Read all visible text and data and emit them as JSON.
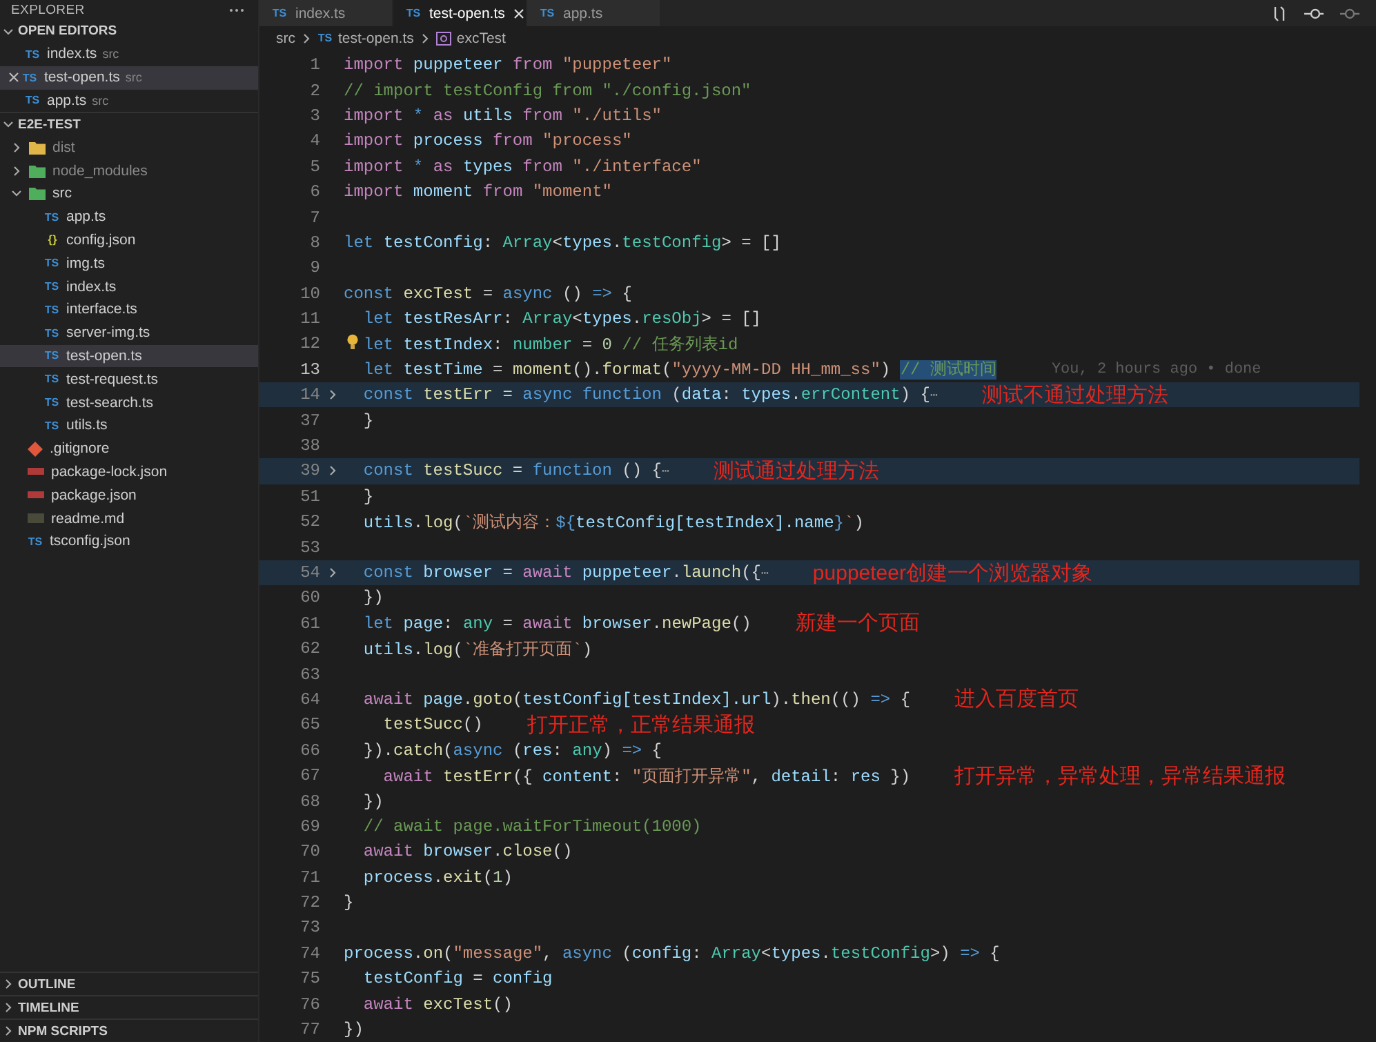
{
  "sidebar": {
    "title": "EXPLORER",
    "open_editors": {
      "title": "OPEN EDITORS",
      "expanded": true,
      "items": [
        {
          "name": "index.ts",
          "dir": "src",
          "kind": "ts",
          "badge": "TS",
          "selected": false
        },
        {
          "name": "test-open.ts",
          "dir": "src",
          "kind": "ts",
          "badge": "TS",
          "selected": true
        },
        {
          "name": "app.ts",
          "dir": "src",
          "kind": "ts",
          "badge": "TS",
          "selected": false
        }
      ]
    },
    "project": {
      "title": "E2E-TEST",
      "expanded": true,
      "items": [
        {
          "name": "dist",
          "kind": "dist",
          "dimmed": true,
          "expanded": false,
          "selected": false
        },
        {
          "name": "node_modules",
          "kind": "modules",
          "dimmed": true,
          "expanded": false,
          "selected": false
        },
        {
          "name": "src",
          "kind": "source",
          "dimmed": false,
          "expanded": true,
          "selected": false,
          "children": [
            {
              "name": "app.ts",
              "kind": "ts",
              "badge": "TS",
              "selected": false
            },
            {
              "name": "config.json",
              "kind": "json",
              "badge": "{ }",
              "selected": false
            },
            {
              "name": "img.ts",
              "kind": "ts",
              "badge": "TS",
              "selected": false
            },
            {
              "name": "index.ts",
              "kind": "ts",
              "badge": "TS",
              "selected": false
            },
            {
              "name": "interface.ts",
              "kind": "ts",
              "badge": "TS",
              "selected": false
            },
            {
              "name": "server-img.ts",
              "kind": "ts",
              "badge": "TS",
              "selected": false
            },
            {
              "name": "test-open.ts",
              "kind": "ts",
              "badge": "TS",
              "selected": true
            },
            {
              "name": "test-request.ts",
              "kind": "ts",
              "badge": "TS",
              "selected": false
            },
            {
              "name": "test-search.ts",
              "kind": "ts",
              "badge": "TS",
              "selected": false
            },
            {
              "name": "utils.ts",
              "kind": "ts",
              "badge": "TS",
              "selected": false
            }
          ]
        },
        {
          "name": ".gitignore",
          "kind": "git",
          "selected": false
        },
        {
          "name": "package-lock.json",
          "kind": "npm",
          "selected": false
        },
        {
          "name": "package.json",
          "kind": "npm",
          "selected": false
        },
        {
          "name": "readme.md",
          "kind": "md",
          "selected": false
        },
        {
          "name": "tsconfig.json",
          "kind": "tsconfig",
          "badge": "TS",
          "selected": false
        }
      ]
    },
    "panels": [
      {
        "title": "OUTLINE",
        "expanded": false
      },
      {
        "title": "TIMELINE",
        "expanded": false
      },
      {
        "title": "NPM SCRIPTS",
        "expanded": false
      }
    ]
  },
  "tabs": [
    {
      "label": "index.ts",
      "badge": "TS",
      "selected": false
    },
    {
      "label": "test-open.ts",
      "badge": "TS",
      "selected": true
    },
    {
      "label": "app.ts",
      "badge": "TS",
      "selected": false
    }
  ],
  "breadcrumb": {
    "folder": "src",
    "file": "test-open.ts",
    "file_badge": "TS",
    "symbol": "excTest"
  },
  "lines": [
    {
      "n": "1",
      "code": [
        {
          "text": "import ",
          "kind": "kw"
        },
        {
          "text": "puppeteer ",
          "kind": "var"
        },
        {
          "text": "from ",
          "kind": "kw"
        },
        {
          "text": "\"puppeteer\"",
          "kind": "str"
        }
      ]
    },
    {
      "n": "2",
      "code": [
        {
          "text": "// import testConfig from \"./config.json\"",
          "kind": "cm"
        }
      ]
    },
    {
      "n": "3",
      "code": [
        {
          "text": "import ",
          "kind": "kw"
        },
        {
          "text": "* ",
          "kind": "decl"
        },
        {
          "text": "as ",
          "kind": "kw"
        },
        {
          "text": "utils ",
          "kind": "var"
        },
        {
          "text": "from ",
          "kind": "kw"
        },
        {
          "text": "\"./utils\"",
          "kind": "str"
        }
      ]
    },
    {
      "n": "4",
      "code": [
        {
          "text": "import ",
          "kind": "kw"
        },
        {
          "text": "process ",
          "kind": "var"
        },
        {
          "text": "from ",
          "kind": "kw"
        },
        {
          "text": "\"process\"",
          "kind": "str"
        }
      ]
    },
    {
      "n": "5",
      "code": [
        {
          "text": "import ",
          "kind": "kw"
        },
        {
          "text": "* ",
          "kind": "decl"
        },
        {
          "text": "as ",
          "kind": "kw"
        },
        {
          "text": "types ",
          "kind": "var"
        },
        {
          "text": "from ",
          "kind": "kw"
        },
        {
          "text": "\"./interface\"",
          "kind": "str"
        }
      ]
    },
    {
      "n": "6",
      "code": [
        {
          "text": "import ",
          "kind": "kw"
        },
        {
          "text": "moment ",
          "kind": "var"
        },
        {
          "text": "from ",
          "kind": "kw"
        },
        {
          "text": "\"moment\"",
          "kind": "str"
        }
      ]
    },
    {
      "n": "7"
    },
    {
      "n": "8",
      "code": [
        {
          "text": "let ",
          "kind": "decl"
        },
        {
          "text": "testConfig",
          "kind": "var"
        },
        {
          "text": ": ",
          "kind": "p"
        },
        {
          "text": "Array",
          "kind": "type"
        },
        {
          "text": "<",
          "kind": "p"
        },
        {
          "text": "types",
          "kind": "var"
        },
        {
          "text": ".",
          "kind": "p"
        },
        {
          "text": "testConfig",
          "kind": "type"
        },
        {
          "text": "> = []",
          "kind": "p"
        }
      ]
    },
    {
      "n": "9"
    },
    {
      "n": "10",
      "code": [
        {
          "text": "const ",
          "kind": "decl"
        },
        {
          "text": "excTest",
          "kind": "fn"
        },
        {
          "text": " = ",
          "kind": "p"
        },
        {
          "text": "async ",
          "kind": "decl"
        },
        {
          "text": "() ",
          "kind": "p"
        },
        {
          "text": "=> ",
          "kind": "decl"
        },
        {
          "text": "{",
          "kind": "p"
        }
      ]
    },
    {
      "n": "11",
      "code": [
        {
          "text": "  let ",
          "kind": "decl"
        },
        {
          "text": "testResArr",
          "kind": "var"
        },
        {
          "text": ": ",
          "kind": "p"
        },
        {
          "text": "Array",
          "kind": "type"
        },
        {
          "text": "<",
          "kind": "p"
        },
        {
          "text": "types",
          "kind": "var"
        },
        {
          "text": ".",
          "kind": "p"
        },
        {
          "text": "resObj",
          "kind": "type"
        },
        {
          "text": "> = []",
          "kind": "p"
        }
      ]
    },
    {
      "n": "12",
      "lightbulb": true,
      "code": [
        {
          "text": "  let ",
          "kind": "decl"
        },
        {
          "text": "testIndex",
          "kind": "var"
        },
        {
          "text": ": ",
          "kind": "p"
        },
        {
          "text": "number",
          "kind": "type"
        },
        {
          "text": " = ",
          "kind": "p"
        },
        {
          "text": "0 ",
          "kind": "num"
        },
        {
          "text": "// 任务列表id",
          "kind": "cm"
        }
      ]
    },
    {
      "n": "13",
      "current": true,
      "code": [
        {
          "text": "  let ",
          "kind": "decl"
        },
        {
          "text": "testTime",
          "kind": "var"
        },
        {
          "text": " = ",
          "kind": "p"
        },
        {
          "text": "moment",
          "kind": "fn"
        },
        {
          "text": "().",
          "kind": "p"
        },
        {
          "text": "format",
          "kind": "fn"
        },
        {
          "text": "(",
          "kind": "p"
        },
        {
          "text": "\"yyyy-MM-DD HH_mm_ss\"",
          "kind": "str"
        },
        {
          "text": ") ",
          "kind": "p"
        },
        {
          "text": "// 测试时间",
          "kind": "sel"
        }
      ],
      "blame": "You, 2 hours ago • done"
    },
    {
      "n": "14",
      "fold": true,
      "highlighted": true,
      "code": [
        {
          "text": "  const ",
          "kind": "decl"
        },
        {
          "text": "testErr",
          "kind": "fn"
        },
        {
          "text": " = ",
          "kind": "p"
        },
        {
          "text": "async function ",
          "kind": "decl"
        },
        {
          "text": "(",
          "kind": "p"
        },
        {
          "text": "data",
          "kind": "var"
        },
        {
          "text": ": ",
          "kind": "p"
        },
        {
          "text": "types",
          "kind": "var"
        },
        {
          "text": ".",
          "kind": "p"
        },
        {
          "text": "errContent",
          "kind": "type"
        },
        {
          "text": ") {",
          "kind": "p"
        },
        {
          "text": "⋯",
          "kind": "ell"
        }
      ],
      "note": "测试不通过处理方法"
    },
    {
      "n": "37",
      "code": [
        {
          "text": "  }",
          "kind": "p"
        }
      ]
    },
    {
      "n": "38"
    },
    {
      "n": "39",
      "fold": true,
      "highlighted": true,
      "code": [
        {
          "text": "  const ",
          "kind": "decl"
        },
        {
          "text": "testSucc",
          "kind": "fn"
        },
        {
          "text": " = ",
          "kind": "p"
        },
        {
          "text": "function ",
          "kind": "decl"
        },
        {
          "text": "() {",
          "kind": "p"
        },
        {
          "text": "⋯",
          "kind": "ell"
        }
      ],
      "note": "测试通过处理方法"
    },
    {
      "n": "51",
      "code": [
        {
          "text": "  }",
          "kind": "p"
        }
      ]
    },
    {
      "n": "52",
      "code": [
        {
          "text": "  utils",
          "kind": "var"
        },
        {
          "text": ".",
          "kind": "p"
        },
        {
          "text": "log",
          "kind": "fn"
        },
        {
          "text": "(",
          "kind": "p"
        },
        {
          "text": "`测试内容：",
          "kind": "str"
        },
        {
          "text": "${",
          "kind": "decl"
        },
        {
          "text": "testConfig[testIndex].name",
          "kind": "var"
        },
        {
          "text": "}",
          "kind": "decl"
        },
        {
          "text": "`",
          "kind": "str"
        },
        {
          "text": ")",
          "kind": "p"
        }
      ]
    },
    {
      "n": "53"
    },
    {
      "n": "54",
      "fold": true,
      "highlighted": true,
      "code": [
        {
          "text": "  const ",
          "kind": "decl"
        },
        {
          "text": "browser",
          "kind": "var"
        },
        {
          "text": " = ",
          "kind": "p"
        },
        {
          "text": "await ",
          "kind": "kw"
        },
        {
          "text": "puppeteer",
          "kind": "var"
        },
        {
          "text": ".",
          "kind": "p"
        },
        {
          "text": "launch",
          "kind": "fn"
        },
        {
          "text": "({",
          "kind": "p"
        },
        {
          "text": "⋯",
          "kind": "ell"
        }
      ],
      "note": "puppeteer创建一个浏览器对象"
    },
    {
      "n": "60",
      "code": [
        {
          "text": "  })",
          "kind": "p"
        }
      ]
    },
    {
      "n": "61",
      "code": [
        {
          "text": "  let ",
          "kind": "decl"
        },
        {
          "text": "page",
          "kind": "var"
        },
        {
          "text": ": ",
          "kind": "p"
        },
        {
          "text": "any",
          "kind": "type"
        },
        {
          "text": " = ",
          "kind": "p"
        },
        {
          "text": "await ",
          "kind": "kw"
        },
        {
          "text": "browser",
          "kind": "var"
        },
        {
          "text": ".",
          "kind": "p"
        },
        {
          "text": "newPage",
          "kind": "fn"
        },
        {
          "text": "()",
          "kind": "p"
        }
      ],
      "note": "新建一个页面"
    },
    {
      "n": "62",
      "code": [
        {
          "text": "  utils",
          "kind": "var"
        },
        {
          "text": ".",
          "kind": "p"
        },
        {
          "text": "log",
          "kind": "fn"
        },
        {
          "text": "(",
          "kind": "p"
        },
        {
          "text": "`准备打开页面`",
          "kind": "str"
        },
        {
          "text": ")",
          "kind": "p"
        }
      ]
    },
    {
      "n": "63"
    },
    {
      "n": "64",
      "code": [
        {
          "text": "  await ",
          "kind": "kw"
        },
        {
          "text": "page",
          "kind": "var"
        },
        {
          "text": ".",
          "kind": "p"
        },
        {
          "text": "goto",
          "kind": "fn"
        },
        {
          "text": "(",
          "kind": "p"
        },
        {
          "text": "testConfig[testIndex].url",
          "kind": "var"
        },
        {
          "text": ").",
          "kind": "p"
        },
        {
          "text": "then",
          "kind": "fn"
        },
        {
          "text": "(() ",
          "kind": "p"
        },
        {
          "text": "=> ",
          "kind": "decl"
        },
        {
          "text": "{",
          "kind": "p"
        }
      ],
      "note": "进入百度首页"
    },
    {
      "n": "65",
      "code": [
        {
          "text": "    testSucc",
          "kind": "fn"
        },
        {
          "text": "()",
          "kind": "p"
        }
      ],
      "note": "打开正常，正常结果通报"
    },
    {
      "n": "66",
      "code": [
        {
          "text": "  }).",
          "kind": "p"
        },
        {
          "text": "catch",
          "kind": "fn"
        },
        {
          "text": "(",
          "kind": "p"
        },
        {
          "text": "async ",
          "kind": "decl"
        },
        {
          "text": "(",
          "kind": "p"
        },
        {
          "text": "res",
          "kind": "var"
        },
        {
          "text": ": ",
          "kind": "p"
        },
        {
          "text": "any",
          "kind": "type"
        },
        {
          "text": ") ",
          "kind": "p"
        },
        {
          "text": "=> ",
          "kind": "decl"
        },
        {
          "text": "{",
          "kind": "p"
        }
      ]
    },
    {
      "n": "67",
      "code": [
        {
          "text": "    await ",
          "kind": "kw"
        },
        {
          "text": "testErr",
          "kind": "fn"
        },
        {
          "text": "({ ",
          "kind": "p"
        },
        {
          "text": "content",
          "kind": "var"
        },
        {
          "text": ": ",
          "kind": "p"
        },
        {
          "text": "\"页面打开异常\"",
          "kind": "str"
        },
        {
          "text": ", ",
          "kind": "p"
        },
        {
          "text": "detail",
          "kind": "var"
        },
        {
          "text": ": ",
          "kind": "p"
        },
        {
          "text": "res",
          "kind": "var"
        },
        {
          "text": " })",
          "kind": "p"
        }
      ],
      "note": "打开异常，异常处理，异常结果通报"
    },
    {
      "n": "68",
      "code": [
        {
          "text": "  })",
          "kind": "p"
        }
      ]
    },
    {
      "n": "69",
      "code": [
        {
          "text": "  // await page.waitForTimeout(1000)",
          "kind": "cm"
        }
      ]
    },
    {
      "n": "70",
      "code": [
        {
          "text": "  await ",
          "kind": "kw"
        },
        {
          "text": "browser",
          "kind": "var"
        },
        {
          "text": ".",
          "kind": "p"
        },
        {
          "text": "close",
          "kind": "fn"
        },
        {
          "text": "()",
          "kind": "p"
        }
      ]
    },
    {
      "n": "71",
      "code": [
        {
          "text": "  process",
          "kind": "var"
        },
        {
          "text": ".",
          "kind": "p"
        },
        {
          "text": "exit",
          "kind": "fn"
        },
        {
          "text": "(",
          "kind": "p"
        },
        {
          "text": "1",
          "kind": "num"
        },
        {
          "text": ")",
          "kind": "p"
        }
      ]
    },
    {
      "n": "72",
      "code": [
        {
          "text": "}",
          "kind": "p"
        }
      ]
    },
    {
      "n": "73"
    },
    {
      "n": "74",
      "code": [
        {
          "text": "process",
          "kind": "var"
        },
        {
          "text": ".",
          "kind": "p"
        },
        {
          "text": "on",
          "kind": "fn"
        },
        {
          "text": "(",
          "kind": "p"
        },
        {
          "text": "\"message\"",
          "kind": "str"
        },
        {
          "text": ", ",
          "kind": "p"
        },
        {
          "text": "async ",
          "kind": "decl"
        },
        {
          "text": "(",
          "kind": "p"
        },
        {
          "text": "config",
          "kind": "var"
        },
        {
          "text": ": ",
          "kind": "p"
        },
        {
          "text": "Array",
          "kind": "type"
        },
        {
          "text": "<",
          "kind": "p"
        },
        {
          "text": "types",
          "kind": "var"
        },
        {
          "text": ".",
          "kind": "p"
        },
        {
          "text": "testConfig",
          "kind": "type"
        },
        {
          "text": ">) ",
          "kind": "p"
        },
        {
          "text": "=> ",
          "kind": "decl"
        },
        {
          "text": "{",
          "kind": "p"
        }
      ]
    },
    {
      "n": "75",
      "code": [
        {
          "text": "  testConfig",
          "kind": "var"
        },
        {
          "text": " = ",
          "kind": "p"
        },
        {
          "text": "config",
          "kind": "var"
        }
      ]
    },
    {
      "n": "76",
      "code": [
        {
          "text": "  await ",
          "kind": "kw"
        },
        {
          "text": "excTest",
          "kind": "fn"
        },
        {
          "text": "()",
          "kind": "p"
        }
      ]
    },
    {
      "n": "77",
      "code": [
        {
          "text": "})",
          "kind": "p"
        }
      ]
    }
  ]
}
